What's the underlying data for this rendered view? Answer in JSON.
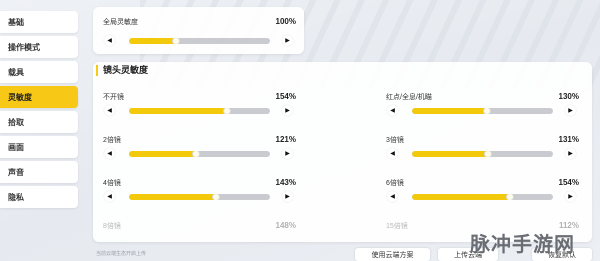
{
  "sidebar": {
    "items": [
      {
        "label": "基础"
      },
      {
        "label": "操作模式"
      },
      {
        "label": "载具"
      },
      {
        "label": "灵敏度",
        "active": true
      },
      {
        "label": "拾取"
      },
      {
        "label": "画面"
      },
      {
        "label": "声音"
      },
      {
        "label": "隐私"
      }
    ]
  },
  "global": {
    "label": "全局灵敏度",
    "value_text": "100%",
    "value": 100,
    "knob_text": "100"
  },
  "section": {
    "title": "镜头灵敏度"
  },
  "scopes": [
    {
      "label": "不开镜",
      "value_text": "154%",
      "value": 154
    },
    {
      "label": "红点/全息/机瞄",
      "value_text": "130%",
      "value": 130
    },
    {
      "label": "2倍镜",
      "value_text": "121%",
      "value": 121
    },
    {
      "label": "3倍镜",
      "value_text": "131%",
      "value": 131
    },
    {
      "label": "4倍镜",
      "value_text": "143%",
      "value": 143
    },
    {
      "label": "6倍镜",
      "value_text": "154%",
      "value": 154
    },
    {
      "label": "8倍镜",
      "value_text": "148%",
      "value": 148
    },
    {
      "label": "15倍镜",
      "value_text": "112%",
      "value": 112
    }
  ],
  "slider_range": {
    "min": 50,
    "max": 200
  },
  "footer": {
    "hint": "当前云端生态开启上传",
    "use_cloud": "使用云端方案",
    "upload": "上传云端",
    "restore": "恢复默认"
  },
  "watermark": "脉冲手游网",
  "colors": {
    "accent": "#f7c815"
  }
}
